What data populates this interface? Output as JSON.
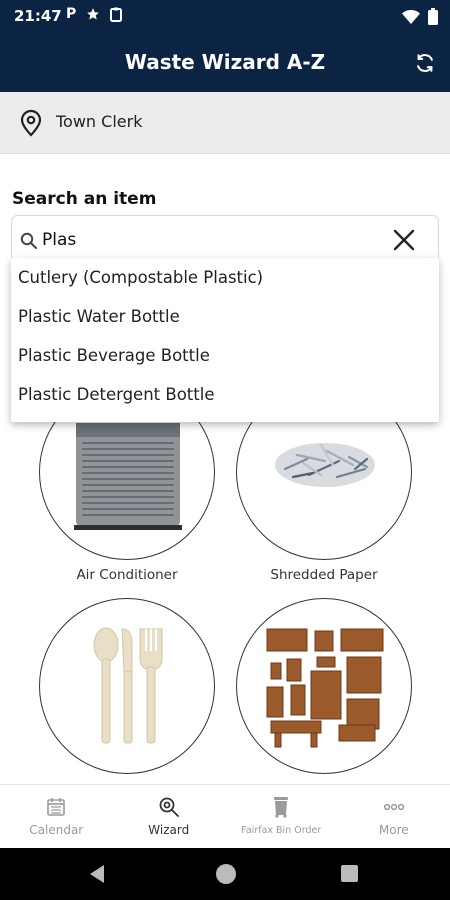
{
  "status_bar": {
    "time": "21:47"
  },
  "app_bar": {
    "title": "Waste Wizard A-Z"
  },
  "location": {
    "label": "Town Clerk"
  },
  "search": {
    "label": "Search an item",
    "value": "Plas"
  },
  "suggestions": [
    "Cutlery (Compostable Plastic)",
    "Plastic Water Bottle",
    "Plastic Beverage Bottle",
    "Plastic Detergent Bottle"
  ],
  "grid_items": [
    {
      "label": "Air Conditioner"
    },
    {
      "label": "Shredded Paper"
    },
    {
      "label": ""
    },
    {
      "label": ""
    }
  ],
  "bottom_nav": {
    "items": [
      {
        "label": "Calendar",
        "icon": "calendar-icon"
      },
      {
        "label": "Wizard",
        "icon": "wizard-search-icon",
        "active": true
      },
      {
        "label": "Fairfax Bin Order",
        "icon": "bin-icon"
      },
      {
        "label": "More",
        "icon": "more-dots-icon"
      }
    ]
  },
  "colors": {
    "header": "#0c2444",
    "location_bar": "#ececec"
  }
}
